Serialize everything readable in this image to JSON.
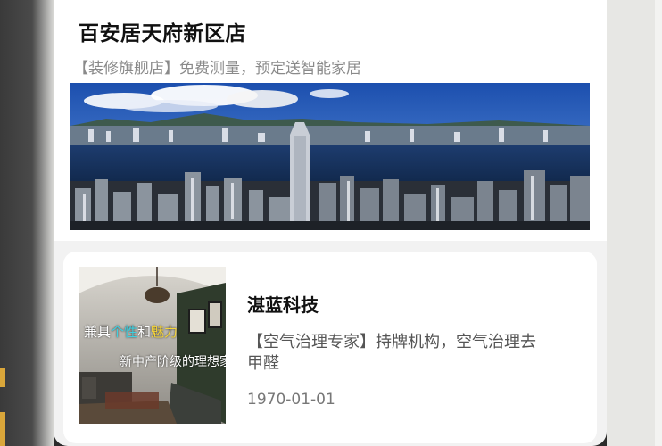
{
  "store": {
    "title": "百安居天府新区店",
    "subtitle": "【装修旗舰店】免费测量，预定送智能家居"
  },
  "item": {
    "title": "湛蓝科技",
    "description": "【空气治理专家】持牌机构，空气治理去甲醛",
    "date": "1970-01-01",
    "thumb_text": {
      "line1_a": "兼具",
      "line1_b": "个性",
      "line1_c": "和",
      "line1_d": "魅力",
      "line2": "新中产阶级的理想家"
    }
  },
  "colors": {
    "accent_cyan": "#3fd0e0",
    "accent_yellow": "#f3d33a",
    "sky": "#1f55b0"
  }
}
